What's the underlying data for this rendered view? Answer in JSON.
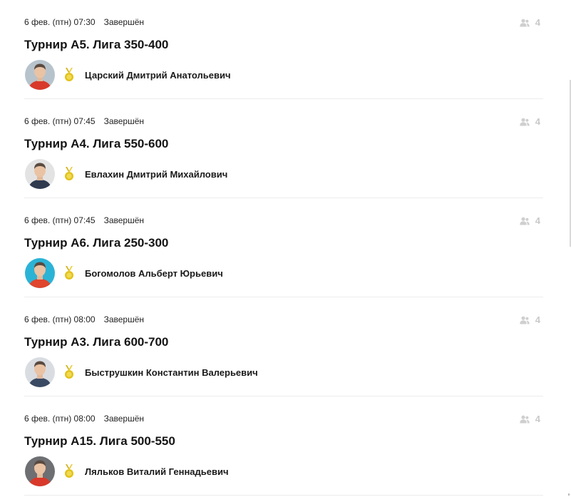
{
  "tournaments": [
    {
      "datetime": "6 фев. (птн) 07:30",
      "status": "Завершён",
      "title": "Турнир А5. Лига 350-400",
      "players_count": "4",
      "winner": "Царский Дмитрий Анатольевич",
      "avatar_bg": "#b7c3cc",
      "shirt_color": "#d8392b"
    },
    {
      "datetime": "6 фев. (птн) 07:45",
      "status": "Завершён",
      "title": "Турнир А4. Лига 550-600",
      "players_count": "4",
      "winner": "Евлахин Дмитрий Михайлович",
      "avatar_bg": "#e3e3e3",
      "shirt_color": "#2f3a4f"
    },
    {
      "datetime": "6 фев. (птн) 07:45",
      "status": "Завершён",
      "title": "Турнир А6. Лига 250-300",
      "players_count": "4",
      "winner": "Богомолов Альберт Юрьевич",
      "avatar_bg": "#2bb3d6",
      "shirt_color": "#e0452d"
    },
    {
      "datetime": "6 фев. (птн) 08:00",
      "status": "Завершён",
      "title": "Турнир А3. Лига 600-700",
      "players_count": "4",
      "winner": "Быструшкин Константин Валерьевич",
      "avatar_bg": "#d9dde2",
      "shirt_color": "#3b4a63"
    },
    {
      "datetime": "6 фев. (птн) 08:00",
      "status": "Завершён",
      "title": "Турнир А15. Лига 500-550",
      "players_count": "4",
      "winner": "Ляльков Виталий Геннадьевич",
      "avatar_bg": "#6d6f73",
      "shirt_color": "#d8392b"
    }
  ],
  "icons": {
    "players": "people-icon",
    "medal": "medal-icon"
  },
  "colors": {
    "medal_gold": "#e2c21b",
    "medal_ribbon": "#d4b11a",
    "muted_icon": "#cfcfcf",
    "divider": "#ececec"
  }
}
